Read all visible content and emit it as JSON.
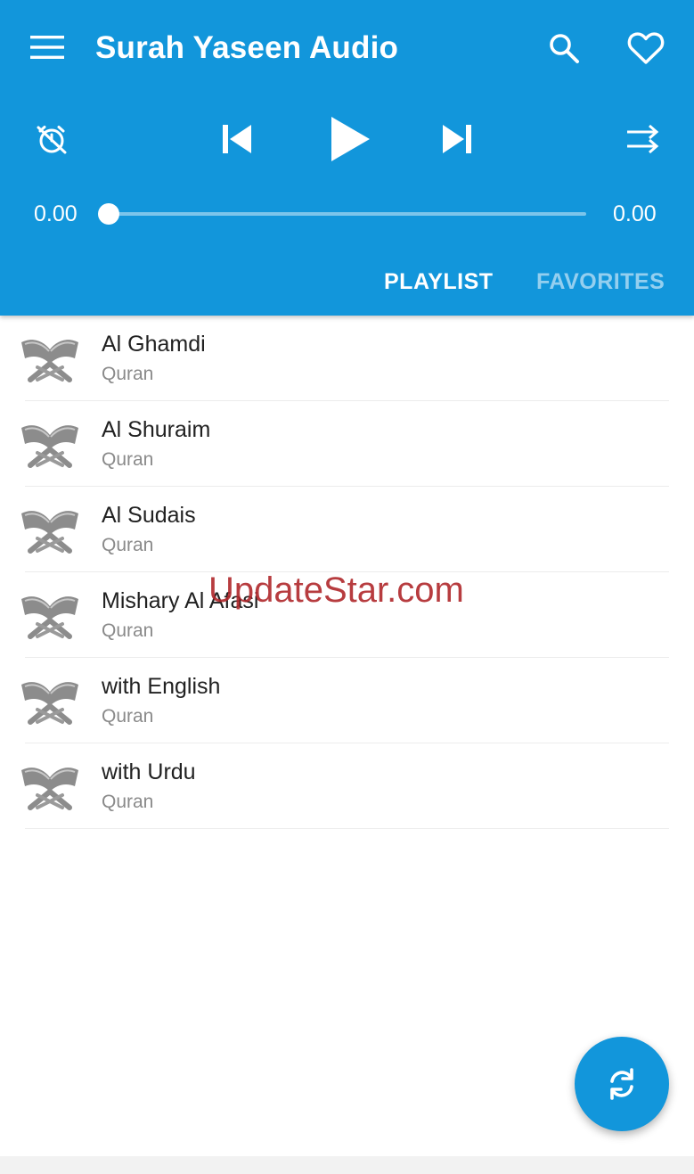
{
  "app": {
    "title": "Surah Yaseen Audio",
    "accent_color": "#1296db"
  },
  "header_icons": {
    "menu": "menu-icon",
    "search": "search-icon",
    "favorite": "heart-icon"
  },
  "player": {
    "controls": [
      "timer-off-icon",
      "skip-previous-icon",
      "play-icon",
      "skip-next-icon",
      "shuffle-icon"
    ],
    "time_elapsed": "0.00",
    "time_total": "0.00",
    "progress": 0
  },
  "tabs": [
    {
      "label": "PLAYLIST",
      "active": true
    },
    {
      "label": "FAVORITES",
      "active": false
    }
  ],
  "playlist": [
    {
      "title": "Al Ghamdi",
      "subtitle": "Quran"
    },
    {
      "title": "Al Shuraim",
      "subtitle": "Quran"
    },
    {
      "title": "Al Sudais",
      "subtitle": "Quran"
    },
    {
      "title": "Mishary Al Afasi",
      "subtitle": "Quran"
    },
    {
      "title": "with English",
      "subtitle": "Quran"
    },
    {
      "title": "with Urdu",
      "subtitle": "Quran"
    }
  ],
  "watermark": "UpdateStar.com",
  "fab": {
    "icon": "refresh-icon"
  }
}
